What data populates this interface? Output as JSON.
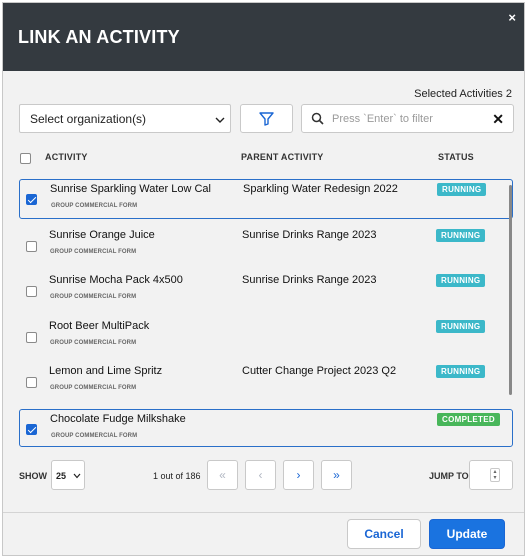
{
  "dialog": {
    "title": "LINK AN ACTIVITY",
    "close_glyph": "×",
    "selected_activities_label": "Selected Activities 2"
  },
  "filters": {
    "org_select_value": "Select organization(s)",
    "filter_icon": "filter-icon",
    "search_placeholder": "Press `Enter` to filter",
    "clear_glyph": "✕"
  },
  "columns": {
    "activity": "ACTIVITY",
    "parent": "PARENT ACTIVITY",
    "status": "STATUS"
  },
  "rows": [
    {
      "name": "Sunrise Sparkling Water Low Cal",
      "type": "GROUP COMMERCIAL FORM",
      "parent": "Sparkling Water Redesign 2022",
      "status": "RUNNING",
      "checked": true
    },
    {
      "name": "Sunrise Orange Juice",
      "type": "GROUP COMMERCIAL FORM",
      "parent": "Sunrise Drinks Range 2023",
      "status": "RUNNING",
      "checked": false
    },
    {
      "name": "Sunrise Mocha Pack 4x500",
      "type": "GROUP COMMERCIAL FORM",
      "parent": "Sunrise Drinks Range 2023",
      "status": "RUNNING",
      "checked": false
    },
    {
      "name": "Root Beer MultiPack",
      "type": "GROUP COMMERCIAL FORM",
      "parent": "",
      "status": "RUNNING",
      "checked": false
    },
    {
      "name": "Lemon and Lime Spritz",
      "type": "GROUP COMMERCIAL FORM",
      "parent": "Cutter Change Project 2023 Q2",
      "status": "RUNNING",
      "checked": false
    },
    {
      "name": "Chocolate Fudge Milkshake",
      "type": "GROUP COMMERCIAL FORM",
      "parent": "",
      "status": "COMPLETED",
      "checked": true
    }
  ],
  "pagination": {
    "show_label": "SHOW",
    "page_size": "25",
    "page_info": "1 out of 186",
    "first_glyph": "«",
    "prev_glyph": "‹",
    "next_glyph": "›",
    "last_glyph": "»",
    "jump_label": "JUMP TO"
  },
  "footer": {
    "cancel_label": "Cancel",
    "update_label": "Update"
  },
  "colors": {
    "header_bg": "#343a40",
    "accent": "#1a73e0",
    "running": "#3cb8c9",
    "completed": "#48b65a"
  }
}
